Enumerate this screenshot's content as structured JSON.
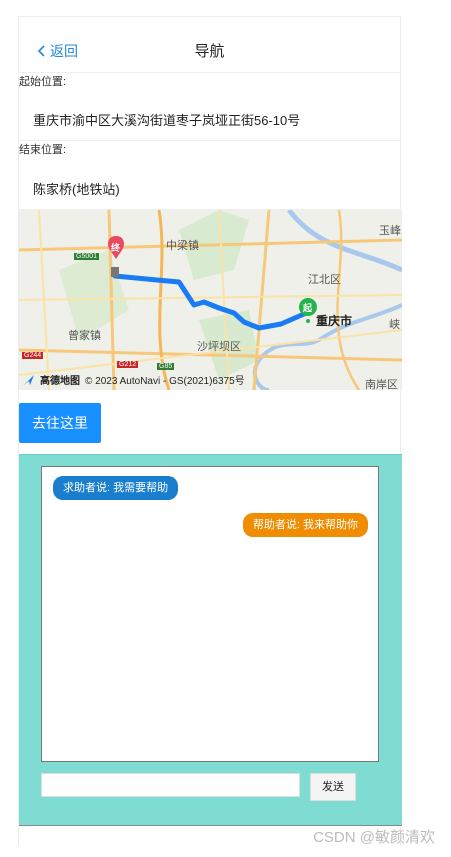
{
  "header": {
    "back_label": "返回",
    "title": "导航"
  },
  "form": {
    "start_label": "起始位置:",
    "start_value": "重庆市渝中区大溪沟街道枣子岚垭正街56-10号",
    "end_label": "结束位置:",
    "end_value": "陈家桥(地铁站)"
  },
  "map": {
    "place_labels": [
      "中梁镇",
      "江北区",
      "重庆市",
      "曾家镇",
      "沙坪坝区",
      "南岸区",
      "玉峰",
      "峡"
    ],
    "start_marker": "起",
    "end_marker": "终",
    "road_tags": [
      "G5001",
      "G244",
      "G212",
      "G85"
    ],
    "logo": "高德地图",
    "copyright": "© 2023 AutoNavi - GS(2021)6375号"
  },
  "actions": {
    "go_label": "去往这里"
  },
  "chat": {
    "messages": [
      {
        "text": "求助者说: 我需要帮助"
      },
      {
        "text": "帮助者说: 我来帮助你"
      }
    ],
    "input_value": "",
    "send_label": "发送"
  },
  "watermark": "CSDN @敏颜清欢"
}
